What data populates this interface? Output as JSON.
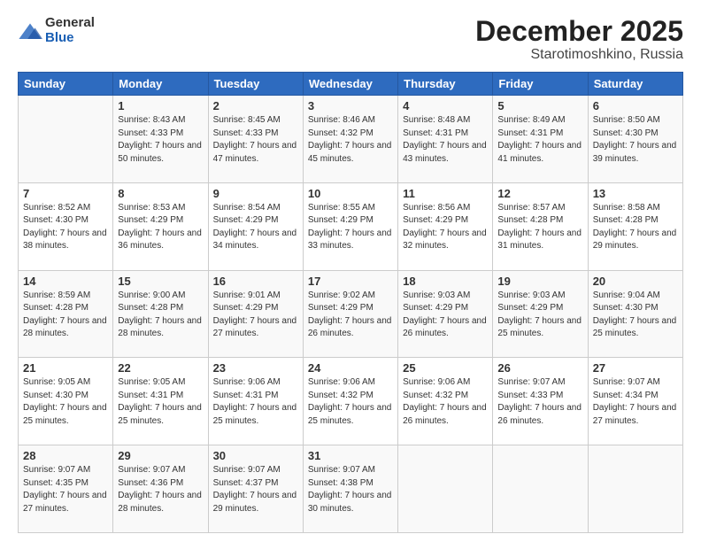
{
  "header": {
    "logo_general": "General",
    "logo_blue": "Blue",
    "main_title": "December 2025",
    "subtitle": "Starotimoshkino, Russia"
  },
  "calendar": {
    "columns": [
      "Sunday",
      "Monday",
      "Tuesday",
      "Wednesday",
      "Thursday",
      "Friday",
      "Saturday"
    ],
    "rows": [
      [
        {
          "day": "",
          "sunrise": "",
          "sunset": "",
          "daylight": ""
        },
        {
          "day": "1",
          "sunrise": "Sunrise: 8:43 AM",
          "sunset": "Sunset: 4:33 PM",
          "daylight": "Daylight: 7 hours and 50 minutes."
        },
        {
          "day": "2",
          "sunrise": "Sunrise: 8:45 AM",
          "sunset": "Sunset: 4:33 PM",
          "daylight": "Daylight: 7 hours and 47 minutes."
        },
        {
          "day": "3",
          "sunrise": "Sunrise: 8:46 AM",
          "sunset": "Sunset: 4:32 PM",
          "daylight": "Daylight: 7 hours and 45 minutes."
        },
        {
          "day": "4",
          "sunrise": "Sunrise: 8:48 AM",
          "sunset": "Sunset: 4:31 PM",
          "daylight": "Daylight: 7 hours and 43 minutes."
        },
        {
          "day": "5",
          "sunrise": "Sunrise: 8:49 AM",
          "sunset": "Sunset: 4:31 PM",
          "daylight": "Daylight: 7 hours and 41 minutes."
        },
        {
          "day": "6",
          "sunrise": "Sunrise: 8:50 AM",
          "sunset": "Sunset: 4:30 PM",
          "daylight": "Daylight: 7 hours and 39 minutes."
        }
      ],
      [
        {
          "day": "7",
          "sunrise": "Sunrise: 8:52 AM",
          "sunset": "Sunset: 4:30 PM",
          "daylight": "Daylight: 7 hours and 38 minutes."
        },
        {
          "day": "8",
          "sunrise": "Sunrise: 8:53 AM",
          "sunset": "Sunset: 4:29 PM",
          "daylight": "Daylight: 7 hours and 36 minutes."
        },
        {
          "day": "9",
          "sunrise": "Sunrise: 8:54 AM",
          "sunset": "Sunset: 4:29 PM",
          "daylight": "Daylight: 7 hours and 34 minutes."
        },
        {
          "day": "10",
          "sunrise": "Sunrise: 8:55 AM",
          "sunset": "Sunset: 4:29 PM",
          "daylight": "Daylight: 7 hours and 33 minutes."
        },
        {
          "day": "11",
          "sunrise": "Sunrise: 8:56 AM",
          "sunset": "Sunset: 4:29 PM",
          "daylight": "Daylight: 7 hours and 32 minutes."
        },
        {
          "day": "12",
          "sunrise": "Sunrise: 8:57 AM",
          "sunset": "Sunset: 4:28 PM",
          "daylight": "Daylight: 7 hours and 31 minutes."
        },
        {
          "day": "13",
          "sunrise": "Sunrise: 8:58 AM",
          "sunset": "Sunset: 4:28 PM",
          "daylight": "Daylight: 7 hours and 29 minutes."
        }
      ],
      [
        {
          "day": "14",
          "sunrise": "Sunrise: 8:59 AM",
          "sunset": "Sunset: 4:28 PM",
          "daylight": "Daylight: 7 hours and 28 minutes."
        },
        {
          "day": "15",
          "sunrise": "Sunrise: 9:00 AM",
          "sunset": "Sunset: 4:28 PM",
          "daylight": "Daylight: 7 hours and 28 minutes."
        },
        {
          "day": "16",
          "sunrise": "Sunrise: 9:01 AM",
          "sunset": "Sunset: 4:29 PM",
          "daylight": "Daylight: 7 hours and 27 minutes."
        },
        {
          "day": "17",
          "sunrise": "Sunrise: 9:02 AM",
          "sunset": "Sunset: 4:29 PM",
          "daylight": "Daylight: 7 hours and 26 minutes."
        },
        {
          "day": "18",
          "sunrise": "Sunrise: 9:03 AM",
          "sunset": "Sunset: 4:29 PM",
          "daylight": "Daylight: 7 hours and 26 minutes."
        },
        {
          "day": "19",
          "sunrise": "Sunrise: 9:03 AM",
          "sunset": "Sunset: 4:29 PM",
          "daylight": "Daylight: 7 hours and 25 minutes."
        },
        {
          "day": "20",
          "sunrise": "Sunrise: 9:04 AM",
          "sunset": "Sunset: 4:30 PM",
          "daylight": "Daylight: 7 hours and 25 minutes."
        }
      ],
      [
        {
          "day": "21",
          "sunrise": "Sunrise: 9:05 AM",
          "sunset": "Sunset: 4:30 PM",
          "daylight": "Daylight: 7 hours and 25 minutes."
        },
        {
          "day": "22",
          "sunrise": "Sunrise: 9:05 AM",
          "sunset": "Sunset: 4:31 PM",
          "daylight": "Daylight: 7 hours and 25 minutes."
        },
        {
          "day": "23",
          "sunrise": "Sunrise: 9:06 AM",
          "sunset": "Sunset: 4:31 PM",
          "daylight": "Daylight: 7 hours and 25 minutes."
        },
        {
          "day": "24",
          "sunrise": "Sunrise: 9:06 AM",
          "sunset": "Sunset: 4:32 PM",
          "daylight": "Daylight: 7 hours and 25 minutes."
        },
        {
          "day": "25",
          "sunrise": "Sunrise: 9:06 AM",
          "sunset": "Sunset: 4:32 PM",
          "daylight": "Daylight: 7 hours and 26 minutes."
        },
        {
          "day": "26",
          "sunrise": "Sunrise: 9:07 AM",
          "sunset": "Sunset: 4:33 PM",
          "daylight": "Daylight: 7 hours and 26 minutes."
        },
        {
          "day": "27",
          "sunrise": "Sunrise: 9:07 AM",
          "sunset": "Sunset: 4:34 PM",
          "daylight": "Daylight: 7 hours and 27 minutes."
        }
      ],
      [
        {
          "day": "28",
          "sunrise": "Sunrise: 9:07 AM",
          "sunset": "Sunset: 4:35 PM",
          "daylight": "Daylight: 7 hours and 27 minutes."
        },
        {
          "day": "29",
          "sunrise": "Sunrise: 9:07 AM",
          "sunset": "Sunset: 4:36 PM",
          "daylight": "Daylight: 7 hours and 28 minutes."
        },
        {
          "day": "30",
          "sunrise": "Sunrise: 9:07 AM",
          "sunset": "Sunset: 4:37 PM",
          "daylight": "Daylight: 7 hours and 29 minutes."
        },
        {
          "day": "31",
          "sunrise": "Sunrise: 9:07 AM",
          "sunset": "Sunset: 4:38 PM",
          "daylight": "Daylight: 7 hours and 30 minutes."
        },
        {
          "day": "",
          "sunrise": "",
          "sunset": "",
          "daylight": ""
        },
        {
          "day": "",
          "sunrise": "",
          "sunset": "",
          "daylight": ""
        },
        {
          "day": "",
          "sunrise": "",
          "sunset": "",
          "daylight": ""
        }
      ]
    ]
  }
}
